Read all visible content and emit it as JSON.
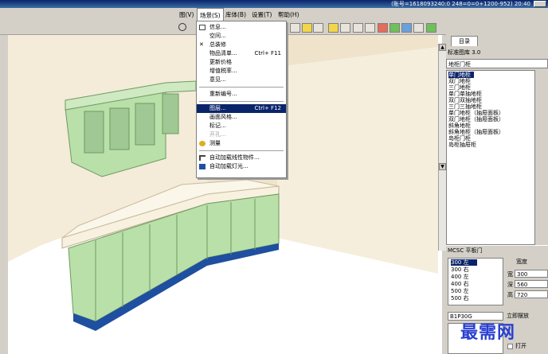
{
  "window": {
    "title": "(账号=1618093240:0 248=0=0+1200-952) 20:40"
  },
  "menubar": {
    "items": [
      {
        "id": "view",
        "label": "图(V)"
      },
      {
        "id": "scene",
        "label": "场景(S)"
      },
      {
        "id": "library",
        "label": "库体(B)"
      },
      {
        "id": "settings",
        "label": "设置(T)"
      },
      {
        "id": "help",
        "label": "帮助(H)"
      }
    ]
  },
  "scene_menu": {
    "items": [
      {
        "label": "信息...",
        "shortcut": "",
        "icon": "info-icon"
      },
      {
        "label": "空间...",
        "shortcut": ""
      },
      {
        "label": "总装修",
        "shortcut": "",
        "icon": "tools-icon"
      },
      {
        "label": "物品清单...",
        "shortcut": "Ctrl+ F11"
      },
      {
        "label": "更新价格",
        "shortcut": ""
      },
      {
        "label": "增值税率...",
        "shortcut": ""
      },
      {
        "label": "意见...",
        "shortcut": ""
      },
      {
        "label": "重新编号...",
        "shortcut": ""
      },
      {
        "label": "图层...",
        "shortcut": "Ctrl+ F12",
        "highlighted": true
      },
      {
        "label": "画面风格...",
        "shortcut": ""
      },
      {
        "label": "标记...",
        "shortcut": ""
      },
      {
        "label": "开孔...",
        "shortcut": "",
        "disabled": true
      },
      {
        "label": "测量",
        "shortcut": "",
        "icon": "measure-icon"
      },
      {
        "label": "自动加载线性物件...",
        "shortcut": "",
        "icon": "line-object-icon"
      },
      {
        "label": "自动加载灯光...",
        "shortcut": "",
        "icon": "light-icon"
      }
    ]
  },
  "right_panel": {
    "tab_label": "目录",
    "library_title": "标准图库 3.0",
    "category": "地柜门柜",
    "items": [
      "单门地柜",
      "双门地柜",
      "三门地柜",
      "单门单抽地柜",
      "双门双抽地柜",
      "三门三抽地柜",
      "单门地柜（抽屉面板）",
      "双门地柜（抽屉面板）",
      "斜角地柜",
      "斜角地柜（抽屉面板）",
      "岛柜门柜",
      "岛柜抽屉柜"
    ],
    "selected_index": 0,
    "mcsc_label": "MCSC    平板门",
    "sizes": [
      "300 左",
      "300 右",
      "400 左",
      "400 右",
      "500 左",
      "500 右"
    ],
    "selected_size_index": 0,
    "dim_header": "宽度",
    "dims": [
      {
        "label": "宽",
        "value": "300"
      },
      {
        "label": "深",
        "value": "560"
      },
      {
        "label": "高",
        "value": "720"
      }
    ],
    "model": "B1P30G",
    "model_button": "立即摆放",
    "open_label": "打开"
  },
  "watermark": "最需网",
  "colors": {
    "title_bar": "#0a246a",
    "highlight": "#0a246a",
    "cabinet": "#b8e0a8",
    "plinth": "#1e4fa0",
    "watermark": "#2a3fd0"
  }
}
